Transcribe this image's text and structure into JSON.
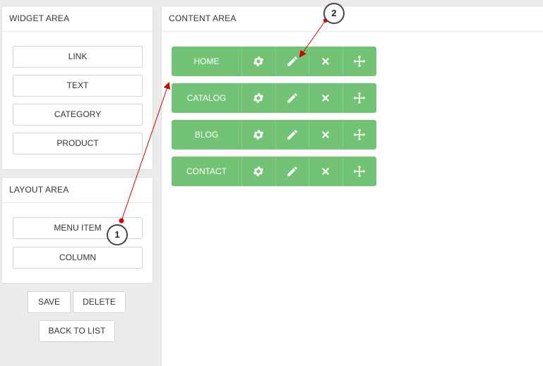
{
  "widget_area": {
    "title": "WIDGET AREA",
    "buttons": [
      "LINK",
      "TEXT",
      "CATEGORY",
      "PRODUCT"
    ]
  },
  "layout_area": {
    "title": "LAYOUT AREA",
    "buttons": [
      "MENU ITEM",
      "COLUMN"
    ]
  },
  "content_area": {
    "title": "CONTENT AREA",
    "menu_items": [
      {
        "label": "HOME"
      },
      {
        "label": "CATALOG"
      },
      {
        "label": "BLOG"
      },
      {
        "label": "CONTACT"
      }
    ],
    "actions": [
      "gear-icon",
      "pencil-icon",
      "close-icon",
      "move-icon"
    ]
  },
  "footer": {
    "save_label": "SAVE",
    "delete_label": "DELETE",
    "back_label": "BACK TO LIST"
  },
  "callouts": {
    "one": "1",
    "two": "2"
  },
  "colors": {
    "menu_green": "#72c376",
    "callout_arrow": "#d40000"
  }
}
